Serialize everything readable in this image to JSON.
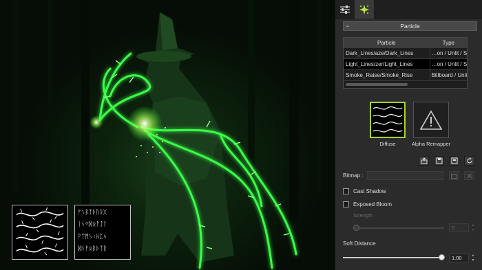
{
  "viewport": {
    "thumbnails": [
      {
        "name": "thorn-lines-thumbnail"
      },
      {
        "name": "rune-glyphs-thumbnail"
      }
    ]
  },
  "tabs": [
    {
      "name": "sliders",
      "icon": "sliders-icon",
      "active": false
    },
    {
      "name": "particle",
      "icon": "particle-burst-icon",
      "active": true
    }
  ],
  "section": {
    "title": "Particle",
    "collapse_symbol": "−"
  },
  "table": {
    "headers": [
      "Particle",
      "Type"
    ],
    "rows": [
      {
        "particle": "Dark_Lines/aze/Dark_Lines",
        "type": "…on / Unlit / Soft",
        "selected": false
      },
      {
        "particle": "Light_Lines/zer/Light_Lines",
        "type": "…on / Unlit / Soft",
        "selected": true
      },
      {
        "particle": "Smoke_Raise/Smoke_Rise",
        "type": "Billboard / Unlit",
        "selected": false
      }
    ]
  },
  "textures": {
    "diffuse_label": "Diffuse",
    "alpha_label": "Alpha Remapper",
    "alpha_icon": "warning-icon",
    "accent": "#a8d230"
  },
  "toolbar": [
    {
      "name": "load-texture-button",
      "icon": "load-icon"
    },
    {
      "name": "save-texture-button",
      "icon": "save-icon"
    },
    {
      "name": "export-texture-button",
      "icon": "export-icon"
    },
    {
      "name": "refresh-texture-button",
      "icon": "refresh-icon"
    }
  ],
  "bitmap": {
    "label": "Bitmap :",
    "value": ""
  },
  "options": {
    "cast_shadow": {
      "label": "Cast Shadow",
      "checked": false
    },
    "exposed_bloom": {
      "label": "Exposed Bloom",
      "checked": false
    }
  },
  "strength": {
    "label": "Strength",
    "value": "0",
    "enabled": false
  },
  "soft_distance": {
    "label": "Soft Distance",
    "value": "1.00",
    "level": 1.0
  }
}
